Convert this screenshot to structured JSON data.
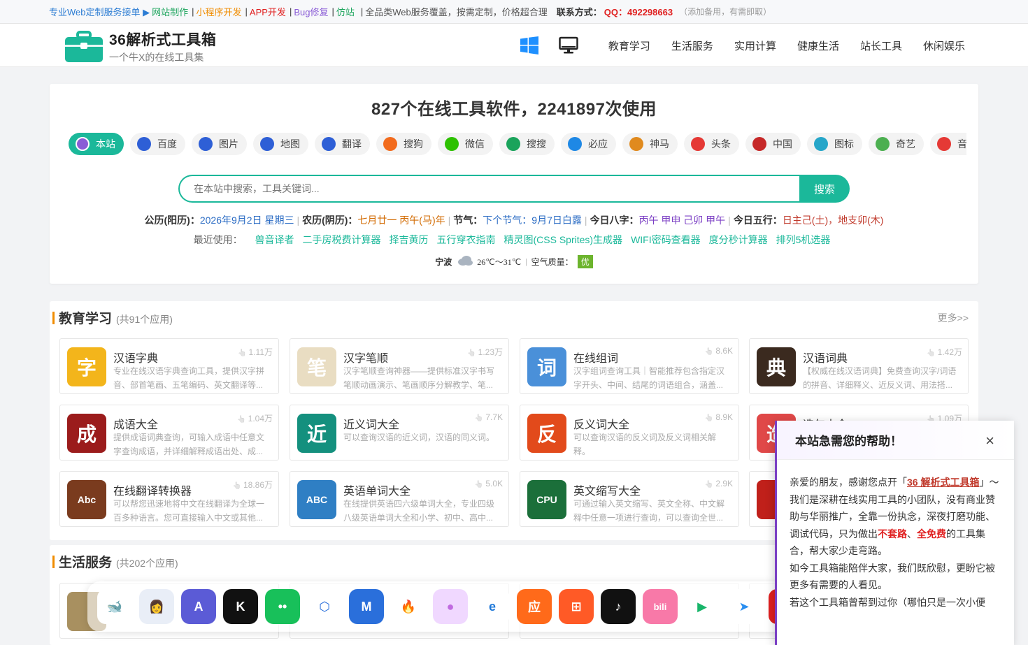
{
  "topbar": {
    "promo": "专业Web定制服务接单 ▶",
    "links": [
      {
        "label": "网站制作",
        "color": "green"
      },
      {
        "label": "小程序开发",
        "color": "orange"
      },
      {
        "label": "APP开发",
        "color": "red"
      },
      {
        "label": "Bug修复",
        "color": "purple"
      },
      {
        "label": "仿站",
        "color": "green"
      }
    ],
    "slogan": "全品类Web服务覆盖，按需定制，价格超合理",
    "contact_label": "联系方式：",
    "qq": "QQ：492298663",
    "note": "（添加备用，有需即取）"
  },
  "header": {
    "logo_title": "36解析式工具箱",
    "logo_sub": "一个牛X的在线工具集",
    "nav_icons": [
      "windows-icon",
      "monitor-icon"
    ],
    "nav": [
      "教育学习",
      "生活服务",
      "实用计算",
      "健康生活",
      "站长工具",
      "休闲娱乐"
    ]
  },
  "hero": {
    "title": "827个在线工具软件，2241897次使用",
    "engines": [
      {
        "label": "本站",
        "icon": "site-icon",
        "color": "#7a4fd0",
        "active": true
      },
      {
        "label": "百度",
        "icon": "baidu-icon",
        "color": "#2e5fd6"
      },
      {
        "label": "图片",
        "icon": "baidu-image-icon",
        "color": "#2e5fd6"
      },
      {
        "label": "地图",
        "icon": "baidu-map-icon",
        "color": "#2e5fd6"
      },
      {
        "label": "翻译",
        "icon": "baidu-translate-icon",
        "color": "#2e5fd6"
      },
      {
        "label": "搜狗",
        "icon": "sogou-icon",
        "color": "#f26b1d"
      },
      {
        "label": "微信",
        "icon": "wechat-icon",
        "color": "#2dc100"
      },
      {
        "label": "搜搜",
        "icon": "soso-icon",
        "color": "#1aa35b"
      },
      {
        "label": "必应",
        "icon": "bing-icon",
        "color": "#1e88e5"
      },
      {
        "label": "神马",
        "icon": "shenma-icon",
        "color": "#e08a1e"
      },
      {
        "label": "头条",
        "icon": "toutiao-icon",
        "color": "#e53935"
      },
      {
        "label": "中国",
        "icon": "china-icon",
        "color": "#c62828"
      },
      {
        "label": "图标",
        "icon": "iconfont-icon",
        "color": "#26a6c9"
      },
      {
        "label": "奇艺",
        "icon": "iqiyi-icon",
        "color": "#4caf50"
      },
      {
        "label": "音乐",
        "icon": "netease-music-icon",
        "color": "#e53935"
      }
    ],
    "search_placeholder": "在本站中搜索，工具关键词...",
    "search_button": "搜索",
    "almanac": {
      "solar_label": "公历(阳历)：",
      "solar": "2026年9月2日 星期三",
      "lunar_label": "农历(阴历)：",
      "lunar": "七月廿一 丙午(马)年",
      "term_label": "节气：",
      "term": "下个节气：9月7日白露",
      "bazi_label": "今日八字：",
      "bazi": "丙午 甲申 己卯 甲午",
      "wuxing_label": "今日五行：",
      "wuxing": "日主己(土)，地支卯(木)"
    },
    "recent_label": "最近使用：",
    "recent": [
      "兽音译者",
      "二手房税费计算器",
      "择吉黄历",
      "五行穿衣指南",
      "精灵图(CSS Sprites)生成器",
      "WIFI密码查看器",
      "度分秒计算器",
      "排列5机选器"
    ],
    "weather": {
      "city": "宁波",
      "icon": "cloud-icon",
      "temp": "26℃～31℃",
      "aq_label": "空气质量：",
      "aq": "优"
    }
  },
  "section_edu": {
    "title": "教育学习",
    "count": "(共91个应用)",
    "more": "更多>>",
    "cards": [
      {
        "name": "汉语字典",
        "views": "1.11万",
        "desc": "专业在线汉语字典查询工具，提供汉字拼音、部首笔画、五笔编码、英文翻译等...",
        "icon": "dictionary-book-icon",
        "bg": "#f3b51b",
        "glyph": "字"
      },
      {
        "name": "汉字笔顺",
        "views": "1.23万",
        "desc": "汉字笔顺查询神器——提供标准汉字书写笔顺动画演示、笔画顺序分解教学、笔...",
        "icon": "stroke-order-icon",
        "bg": "#e9ddc2",
        "glyph": "笔"
      },
      {
        "name": "在线组词",
        "views": "8.6K",
        "desc": "汉字组词查询工具｜智能推荐包含指定汉字开头、中间、结尾的词语组合，涵盖...",
        "icon": "graduation-cap-icon",
        "bg": "#4a90d9",
        "glyph": "词"
      },
      {
        "name": "汉语词典",
        "views": "1.42万",
        "desc": "【权威在线汉语词典】免费查询汉字/词语的拼音、详细释义、近反义词、用法搭...",
        "icon": "chinese-dictionary-icon",
        "bg": "#3b2a1f",
        "glyph": "典"
      },
      {
        "name": "成语大全",
        "views": "1.04万",
        "desc": "提供成语词典查询，可输入成语中任意文字查询成语，并详细解释成语出处、成...",
        "icon": "idiom-book-icon",
        "bg": "#9b1c1c",
        "glyph": "成"
      },
      {
        "name": "近义词大全",
        "views": "7.7K",
        "desc": "可以查询汉语的近义词，汉语的同义词。",
        "icon": "synonym-icon",
        "bg": "#14907e",
        "glyph": "近"
      },
      {
        "name": "反义词大全",
        "views": "8.9K",
        "desc": "可以查询汉语的反义词及反义词相关解释。",
        "icon": "antonym-icon",
        "bg": "#e24a1b",
        "glyph": "反"
      },
      {
        "name": "造句大全",
        "views": "1.09万",
        "desc": "",
        "icon": "sentence-icon",
        "bg": "#e04848",
        "glyph": "造"
      },
      {
        "name": "在线翻译转换器",
        "views": "18.86万",
        "desc": "可以帮您迅速地将中文在线翻译为全球一百多种语言。您可直接输入中文或其他...",
        "icon": "translator-icon",
        "bg": "#7a3b1e",
        "glyph": "Abc"
      },
      {
        "name": "英语单词大全",
        "views": "5.0K",
        "desc": "在线提供英语四六级单词大全，专业四级八级英语单词大全和小学、初中、高中...",
        "icon": "abc-book-icon",
        "bg": "#2f7fc4",
        "glyph": "ABC"
      },
      {
        "name": "英文缩写大全",
        "views": "2.9K",
        "desc": "可通过输入英文缩写、英文全称、中文解释中任意一项进行查询，可以查询全世...",
        "icon": "cpu-abbreviation-icon",
        "bg": "#1b6f3a",
        "glyph": "CPU"
      },
      {
        "name": "",
        "views": "",
        "desc": "",
        "icon": "lantern-icon",
        "bg": "#c0201a",
        "glyph": ""
      }
    ]
  },
  "section_life": {
    "title": "生活服务",
    "count": "(共202个应用)"
  },
  "popup": {
    "title": "本站急需您的帮助！",
    "close": "×",
    "p1_a": "亲爱的朋友，感谢您点开「",
    "p1_link": "36 解析式工具箱",
    "p1_b": "」～",
    "p2_a": "我们是深耕在线实用工具的小团队，没有商业赞助与华丽推广，全靠一份执念，深夜打磨功能、调试代码，只为做出",
    "p2_r1": "不套路",
    "p2_m": "、",
    "p2_r2": "全免费",
    "p2_b": "的工具集合，帮大家少走弯路。",
    "p3": "如今工具箱能陪伴大家，我们既欣慰，更盼它被更多有需要的人看见。",
    "p4": "若这个工具箱曾帮到过你（哪怕只是一次小便"
  },
  "dock": [
    {
      "icon": "deepseek-icon",
      "bg": "#ffffff",
      "fg": "#4d6bfe",
      "glyph": "🐋"
    },
    {
      "icon": "avatar-assistant-icon",
      "bg": "#e9eef7",
      "fg": "#333",
      "glyph": "👩"
    },
    {
      "icon": "app-store-icon",
      "bg": "#5b5bd6",
      "fg": "#fff",
      "glyph": "A"
    },
    {
      "icon": "kimi-icon",
      "bg": "#111111",
      "fg": "#fff",
      "glyph": "K"
    },
    {
      "icon": "green-face-icon",
      "bg": "#18c05a",
      "fg": "#fff",
      "glyph": "••"
    },
    {
      "icon": "hex-browser-icon",
      "bg": "#ffffff",
      "fg": "#2a6fdb",
      "glyph": "⬡"
    },
    {
      "icon": "mountain-app-icon",
      "bg": "#2a6fdb",
      "fg": "#fff",
      "glyph": "M"
    },
    {
      "icon": "flame-icon",
      "bg": "#ffffff",
      "fg": "#2a90e6",
      "glyph": "🔥"
    },
    {
      "icon": "orb-icon",
      "bg": "#f0d8ff",
      "fg": "#c06be0",
      "glyph": "●"
    },
    {
      "icon": "ie-browser-icon",
      "bg": "#ffffff",
      "fg": "#1e78d8",
      "glyph": "e"
    },
    {
      "icon": "app-market-icon",
      "bg": "#ff6a1a",
      "fg": "#fff",
      "glyph": "应"
    },
    {
      "icon": "grid-app-icon",
      "bg": "#ff5a26",
      "fg": "#fff",
      "glyph": "⊞"
    },
    {
      "icon": "tiktok-icon",
      "bg": "#111111",
      "fg": "#fff",
      "glyph": "♪"
    },
    {
      "icon": "bilibili-icon",
      "bg": "#f879a8",
      "fg": "#fff",
      "glyph": "bili"
    },
    {
      "icon": "video-player-icon",
      "bg": "#ffffff",
      "fg": "#18b56a",
      "glyph": "▶"
    },
    {
      "icon": "arrow-app-icon",
      "bg": "#ffffff",
      "fg": "#2a8ef0",
      "glyph": "➤"
    },
    {
      "icon": "red-app-icon",
      "bg": "#e02020",
      "fg": "#fff",
      "glyph": ""
    }
  ]
}
